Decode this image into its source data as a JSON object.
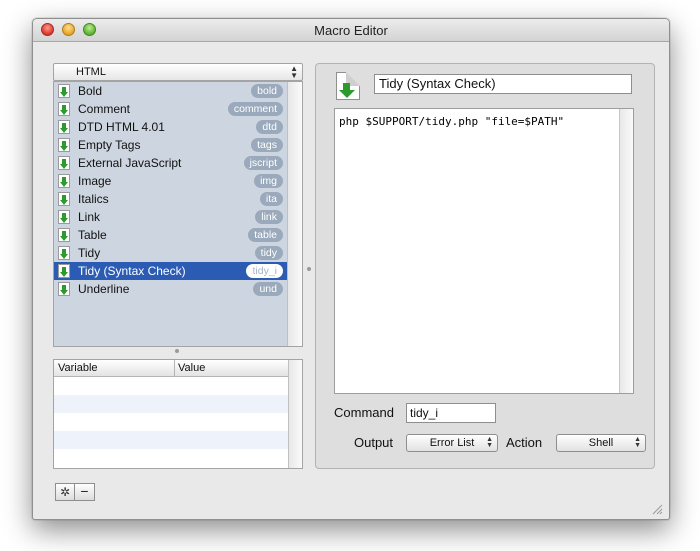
{
  "window": {
    "title": "Macro Editor"
  },
  "left": {
    "group_selector": "HTML",
    "macros": [
      {
        "label": "Bold",
        "badge": "bold",
        "selected": false
      },
      {
        "label": "Comment",
        "badge": "comment",
        "selected": false
      },
      {
        "label": "DTD HTML 4.01",
        "badge": "dtd",
        "selected": false
      },
      {
        "label": "Empty Tags",
        "badge": "tags",
        "selected": false
      },
      {
        "label": "External JavaScript",
        "badge": "jscript",
        "selected": false
      },
      {
        "label": "Image",
        "badge": "img",
        "selected": false
      },
      {
        "label": "Italics",
        "badge": "ita",
        "selected": false
      },
      {
        "label": "Link",
        "badge": "link",
        "selected": false
      },
      {
        "label": "Table",
        "badge": "table",
        "selected": false
      },
      {
        "label": "Tidy",
        "badge": "tidy",
        "selected": false
      },
      {
        "label": "Tidy (Syntax Check)",
        "badge": "tidy_i",
        "selected": true
      },
      {
        "label": "Underline",
        "badge": "und",
        "selected": false
      }
    ],
    "variables": {
      "headers": [
        "Variable",
        "Value"
      ],
      "rows": []
    },
    "buttons": {
      "gear": "✲",
      "remove": "−"
    }
  },
  "right": {
    "macro_name": "Tidy (Syntax Check)",
    "code": "php $SUPPORT/tidy.php \"file=$PATH\"",
    "command_label": "Command",
    "command_value": "tidy_i",
    "output_label": "Output",
    "output_value": "Error List",
    "action_label": "Action",
    "action_value": "Shell"
  },
  "colors": {
    "selection": "#2c5bb4",
    "list_background": "#cdd6e0",
    "badge": "#9aa9bb",
    "arrow_green": "#2d9a2d"
  }
}
